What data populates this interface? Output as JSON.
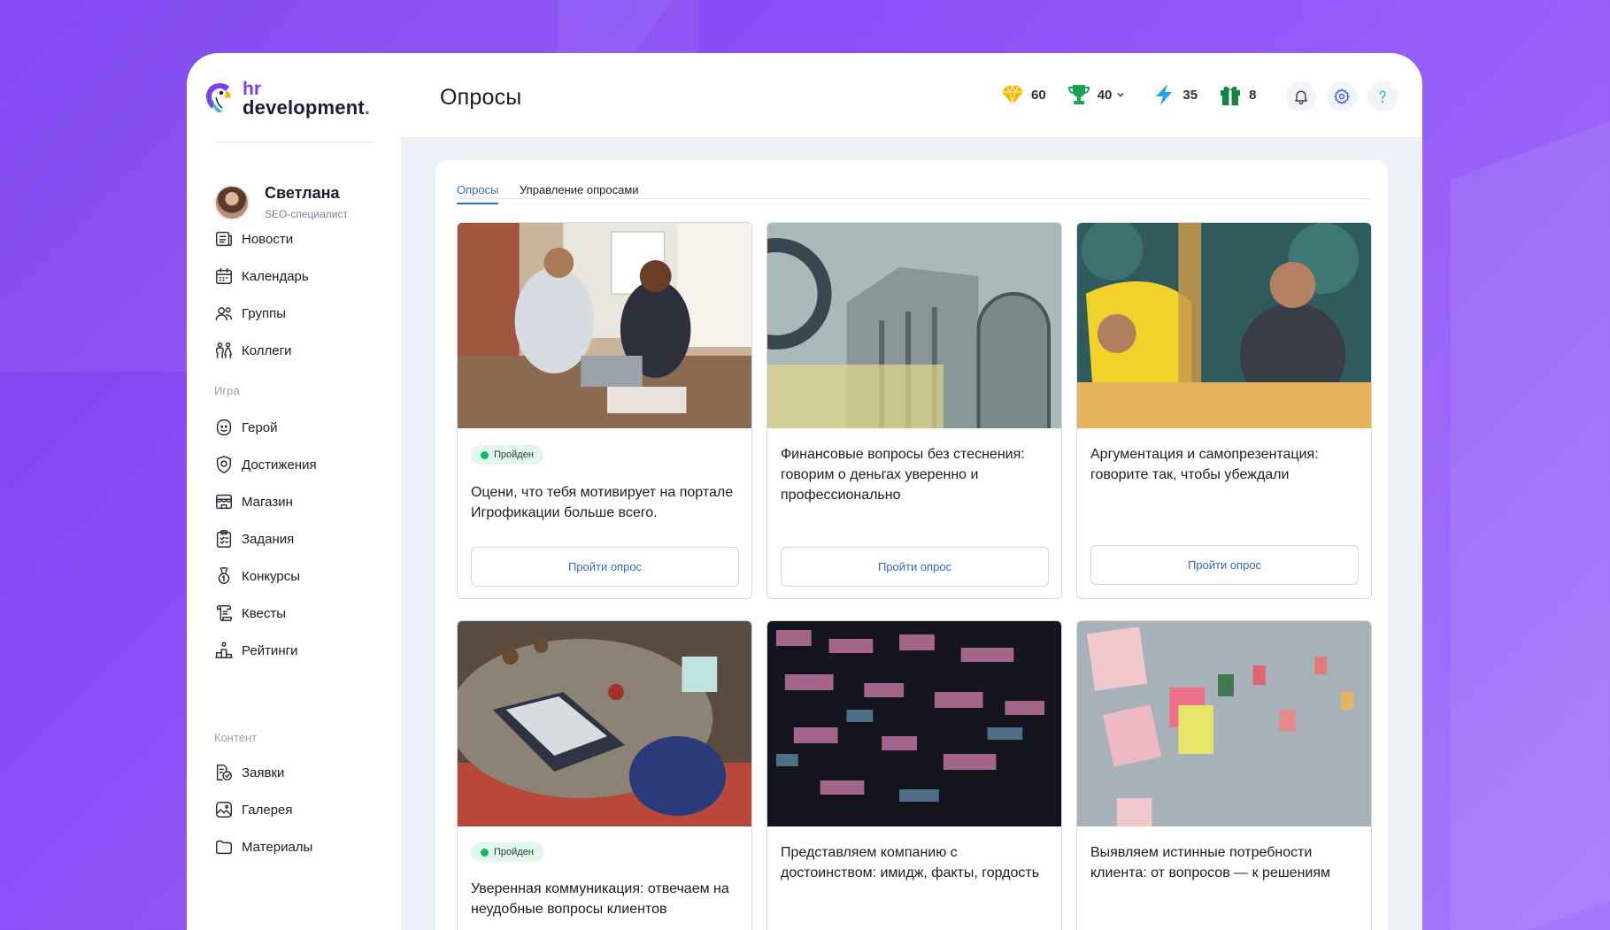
{
  "app": {
    "logo_top": "hr",
    "logo_bottom": "development",
    "logo_dot": ".",
    "brand_color": "#7b3ff0"
  },
  "profile": {
    "name": "Светлана",
    "role": "SEO-специалист"
  },
  "nav": {
    "main": [
      {
        "label": "Новости",
        "icon": "news-icon"
      },
      {
        "label": "Календарь",
        "icon": "calendar-icon"
      },
      {
        "label": "Группы",
        "icon": "groups-icon"
      },
      {
        "label": "Коллеги",
        "icon": "colleagues-icon"
      }
    ],
    "game_section": "Игра",
    "game": [
      {
        "label": "Герой",
        "icon": "hero-icon"
      },
      {
        "label": "Достижения",
        "icon": "achievements-icon"
      },
      {
        "label": "Магазин",
        "icon": "shop-icon"
      },
      {
        "label": "Задания",
        "icon": "tasks-icon"
      },
      {
        "label": "Конкурсы",
        "icon": "contests-icon"
      },
      {
        "label": "Квесты",
        "icon": "quests-icon"
      },
      {
        "label": "Рейтинги",
        "icon": "ratings-icon"
      }
    ],
    "content_section": "Контент",
    "content": [
      {
        "label": "Заявки",
        "icon": "requests-icon"
      },
      {
        "label": "Галерея",
        "icon": "gallery-icon"
      },
      {
        "label": "Материалы",
        "icon": "materials-icon"
      }
    ]
  },
  "header": {
    "title": "Опросы",
    "stats": [
      {
        "icon": "diamond-icon",
        "value": "60",
        "color": "#f5b400"
      },
      {
        "icon": "trophy-icon",
        "value": "40",
        "color": "#17a457"
      },
      {
        "icon": "lightning-icon",
        "value": "35",
        "color": "#1aa6e8"
      },
      {
        "icon": "gift-icon",
        "value": "8",
        "color": "#13843f"
      }
    ],
    "buttons": [
      "bell-icon",
      "gear-icon",
      "help-icon"
    ]
  },
  "tabs": [
    {
      "label": "Опросы",
      "active": true
    },
    {
      "label": "Управление опросами",
      "active": false
    }
  ],
  "cards": [
    {
      "title": "Оцени, что тебя мотивирует на портале Игрофикации больше всего.",
      "badge": "Пройден",
      "button": "Пройти опрос",
      "image": "office-high-five-photo"
    },
    {
      "title": "Финансовые вопросы без стеснения: говорим о деньгах уверенно и профессионально",
      "badge": "",
      "button": "Пройти опрос",
      "image": "banknote-architecture-photo"
    },
    {
      "title": "Аргументация и самопрезентация: говорите так, чтобы убеждали",
      "badge": "",
      "button": "Пройти опрос",
      "image": "man-smiling-meeting-photo"
    },
    {
      "title": "Уверенная коммуникация: отвечаем на неудобные вопросы клиентов",
      "badge": "Пройден",
      "button": "",
      "image": "laptop-holiday-table-photo"
    },
    {
      "title": "Представляем компанию с достоинством: имидж, факты, гордость",
      "badge": "",
      "button": "",
      "image": "night-office-building-photo"
    },
    {
      "title": "Выявляем истинные потребности клиента: от вопросов — к решениям",
      "badge": "",
      "button": "",
      "image": "sticky-notes-wall-photo"
    }
  ]
}
